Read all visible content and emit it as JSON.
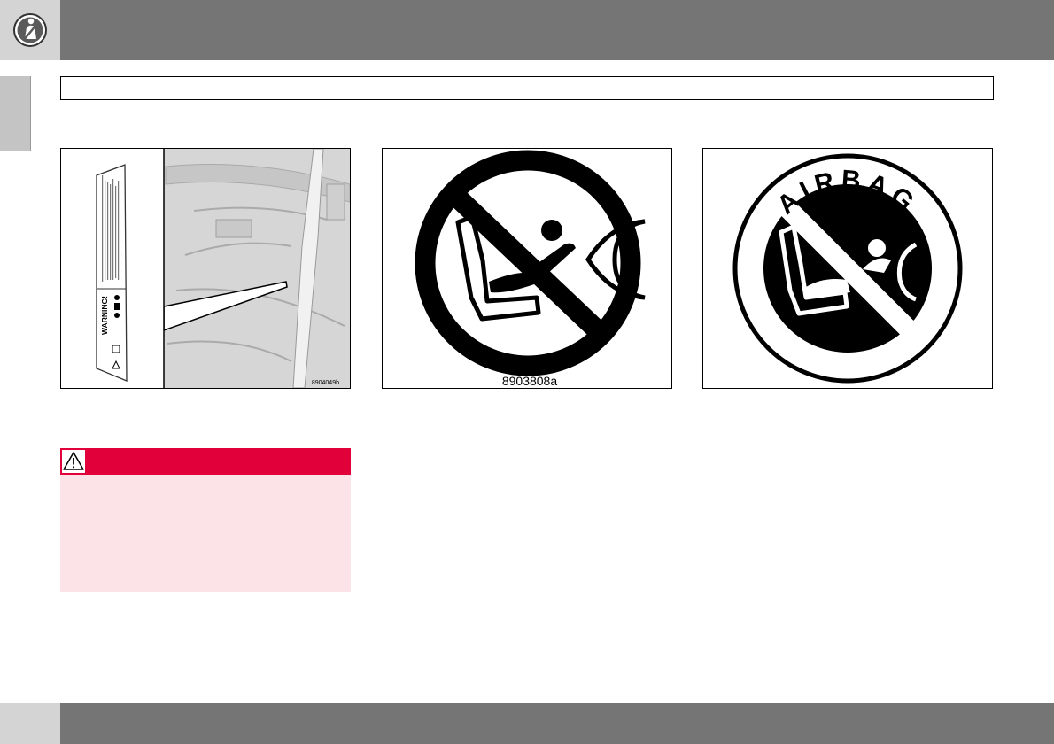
{
  "header": {
    "chapter_icon": "seatbelt-safety-icon"
  },
  "section": {
    "title": ""
  },
  "figures": [
    {
      "code": "8904049b",
      "label_heading": "WARNING!",
      "icon": "airbag-warning-label"
    },
    {
      "code": "8903808a",
      "icon": "no-child-seat-airbag-icon"
    },
    {
      "text": "AIRBAG",
      "icon": "airbag-prohibition-icon"
    }
  ],
  "warning": {
    "icon": "warning-triangle-icon",
    "colors": {
      "header": "#e2003a",
      "body": "#fbe3e8"
    }
  }
}
